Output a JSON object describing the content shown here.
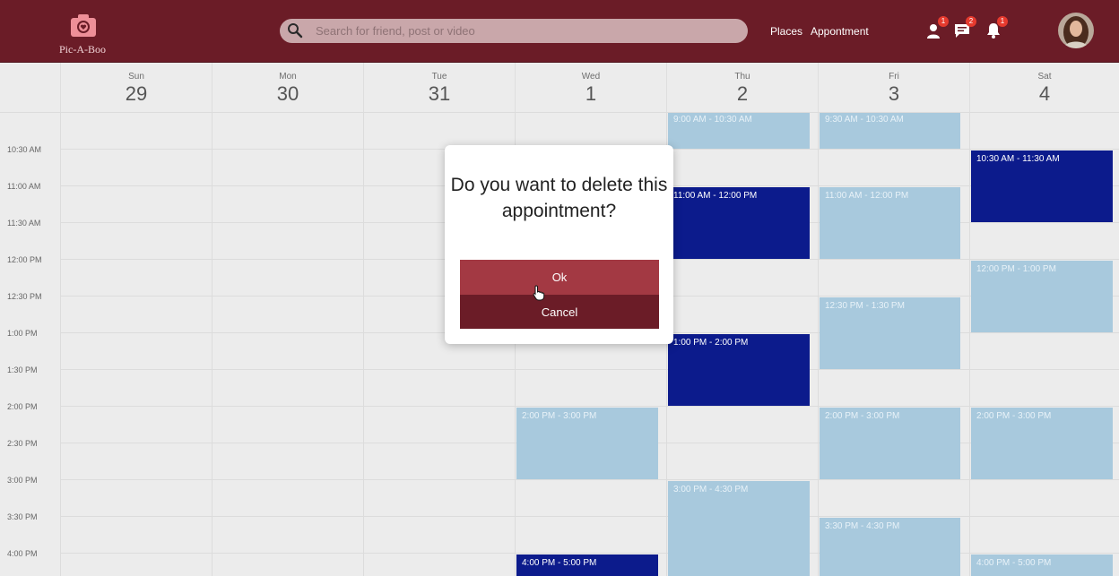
{
  "header": {
    "logo_text": "Pic-A-Boo",
    "search_placeholder": "Search for friend, post or video",
    "nav": [
      "Places",
      "Appontment"
    ],
    "badges": {
      "friends": "1",
      "messages": "2",
      "notifications": "1"
    },
    "colors": {
      "bar": "#6b1c27",
      "badge": "#e63a2e"
    }
  },
  "days": [
    {
      "name": "Sun",
      "num": "29"
    },
    {
      "name": "Mon",
      "num": "30"
    },
    {
      "name": "Tue",
      "num": "31"
    },
    {
      "name": "Wed",
      "num": "1"
    },
    {
      "name": "Thu",
      "num": "2"
    },
    {
      "name": "Fri",
      "num": "3"
    },
    {
      "name": "Sat",
      "num": "4"
    }
  ],
  "times": [
    "10:30 AM",
    "11:00 AM",
    "11:30 AM",
    "12:00 PM",
    "12:30 PM",
    "1:00 PM",
    "1:30 PM",
    "2:00 PM",
    "2:30 PM",
    "3:00 PM",
    "3:30 PM",
    "4:00 PM"
  ],
  "events": [
    {
      "label": "9:00 AM  -  10:30 AM",
      "style": "light"
    },
    {
      "label": "9:30 AM  -  10:30 AM",
      "style": "light"
    },
    {
      "label": "10:30 AM  -  11:30 AM",
      "style": "dark"
    },
    {
      "label": "11:00 AM  -  12:00 PM",
      "style": "dark"
    },
    {
      "label": "11:00 AM  -  12:00 PM",
      "style": "light"
    },
    {
      "label": "12:00 PM  -  1:00 PM",
      "style": "light"
    },
    {
      "label": "12:30 PM  -  1:30 PM",
      "style": "light"
    },
    {
      "label": "1:00 PM  -  2:00 PM",
      "style": "dark"
    },
    {
      "label": "2:00 PM  -  3:00 PM",
      "style": "light"
    },
    {
      "label": "2:00 PM  -  3:00 PM",
      "style": "light"
    },
    {
      "label": "2:00 PM  -  3:00 PM",
      "style": "light"
    },
    {
      "label": "3:00 PM  -  4:30 PM",
      "style": "light"
    },
    {
      "label": "3:30 PM  -  4:30 PM",
      "style": "light"
    },
    {
      "label": "4:00 PM  -  5:00 PM",
      "style": "dark"
    },
    {
      "label": "4:00 PM  -  5:00 PM",
      "style": "light"
    }
  ],
  "event_colors": {
    "light": "#a8c9dd",
    "dark": "#0c1b8c"
  },
  "dialog": {
    "title": "Do you want to delete this appointment?",
    "ok": "Ok",
    "cancel": "Cancel"
  }
}
